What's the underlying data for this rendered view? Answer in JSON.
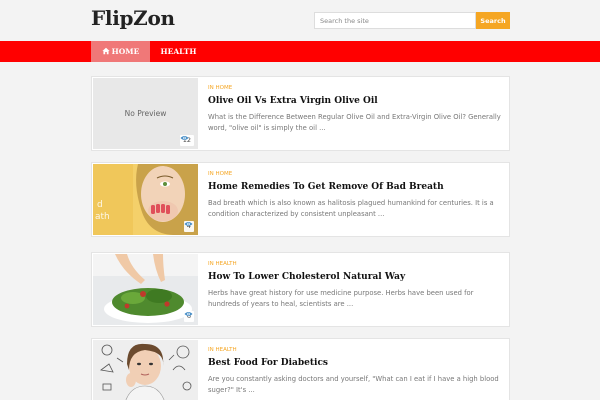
{
  "site": {
    "name": "FlipZon"
  },
  "search": {
    "placeholder": "Search the site",
    "button_label": "Search"
  },
  "nav": {
    "items": [
      {
        "label": "HOME"
      },
      {
        "label": "HEALTH"
      }
    ]
  },
  "colors": {
    "nav_bg": "#ff0000",
    "nav_active": "#f07878",
    "accent": "#f5a623"
  },
  "posts": [
    {
      "category": "IN HOME",
      "title": "Olive Oil Vs Extra Virgin Olive Oil",
      "excerpt": "What is the Difference Between Regular Olive Oil and Extra-Virgin Olive Oil? Generally word, \"olive oil\" is simply the oil ...",
      "views": "12",
      "thumbnail": "No Preview"
    },
    {
      "category": "IN HOME",
      "title": "Home Remedies To Get Remove Of Bad Breath",
      "excerpt": "Bad breath which is also known as halitosis plagued humankind for centuries. It is a condition characterized by consistent unpleasant ...",
      "views": "4",
      "thumbnail_icon": "woman-covering-mouth-photo"
    },
    {
      "category": "IN HEALTH",
      "title": "How To Lower Cholesterol Natural Way",
      "excerpt": "Herbs have great history for use  medicine purpose. Herbs have been used for hundreds of years to heal, scientists are ...",
      "views": "6",
      "thumbnail_icon": "salad-bowl-photo"
    },
    {
      "category": "IN HEALTH",
      "title": "Best Food For Diabetics",
      "excerpt": "  Are you constantly asking doctors and yourself, \"What can I eat if I have a high blood suger?\" It's ...",
      "views": "",
      "thumbnail_icon": "woman-thinking-food-photo"
    }
  ]
}
